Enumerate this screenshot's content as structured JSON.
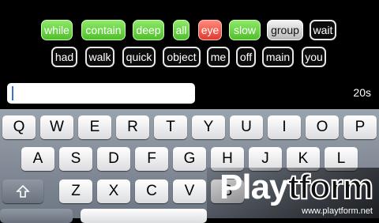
{
  "words": {
    "row1": [
      {
        "text": "while",
        "state": "green"
      },
      {
        "text": "contain",
        "state": "green"
      },
      {
        "text": "deep",
        "state": "green"
      },
      {
        "text": "all",
        "state": "green"
      },
      {
        "text": "eye",
        "state": "red"
      },
      {
        "text": "slow",
        "state": "green"
      },
      {
        "text": "group",
        "state": "gray"
      },
      {
        "text": "wait",
        "state": "dark"
      }
    ],
    "row2": [
      {
        "text": "had",
        "state": "dark"
      },
      {
        "text": "walk",
        "state": "dark"
      },
      {
        "text": "quick",
        "state": "dark"
      },
      {
        "text": "object",
        "state": "dark"
      },
      {
        "text": "me",
        "state": "dark"
      },
      {
        "text": "off",
        "state": "dark"
      },
      {
        "text": "main",
        "state": "dark"
      },
      {
        "text": "you",
        "state": "dark"
      }
    ]
  },
  "input": {
    "value": "",
    "placeholder": ""
  },
  "timer": "20s",
  "keyboard": {
    "row1": [
      "Q",
      "W",
      "E",
      "R",
      "T",
      "Y",
      "U",
      "I",
      "O",
      "P"
    ],
    "row2": [
      "A",
      "S",
      "D",
      "F",
      "G",
      "H",
      "J",
      "K",
      "L"
    ],
    "row3": [
      "Z",
      "X",
      "C",
      "V",
      "B"
    ],
    "shift_icon": "shift-arrow-icon"
  },
  "brand": {
    "name_part1": "Play",
    "name_part2": "tform",
    "url": "www.playtform.net"
  },
  "colors": {
    "green": "#5ccd35",
    "red": "#e8473b",
    "gray": "#d8d8d8",
    "dark": "#0c0c0c"
  }
}
